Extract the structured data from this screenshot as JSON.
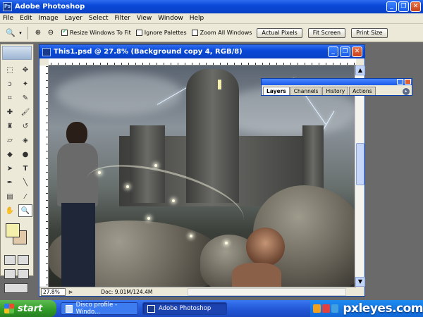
{
  "app": {
    "title": "Adobe Photoshop"
  },
  "menu": [
    "File",
    "Edit",
    "Image",
    "Layer",
    "Select",
    "Filter",
    "View",
    "Window",
    "Help"
  ],
  "options": {
    "resize_windows": "Resize Windows To Fit",
    "ignore_palettes": "Ignore Palettes",
    "zoom_all": "Zoom All Windows",
    "actual_pixels": "Actual Pixels",
    "fit_screen": "Fit Screen",
    "print_size": "Print Size"
  },
  "document": {
    "title": "This1.psd @ 27.8% (Background copy 4, RGB/8)",
    "zoom": "27.8%",
    "doc_size": "Doc: 9.01M/124.4M"
  },
  "layers_palette": {
    "tabs": [
      "Layers",
      "Channels",
      "History",
      "Actions"
    ]
  },
  "taskbar": {
    "start": "start",
    "tasks": [
      "Disco profile - Windo...",
      "Adobe Photoshop"
    ],
    "watermark": "pxleyes.com"
  },
  "colors": {
    "foreground": "#f4efaa",
    "background": "#e0c8a8",
    "titlebar": "#0a4ad8"
  }
}
